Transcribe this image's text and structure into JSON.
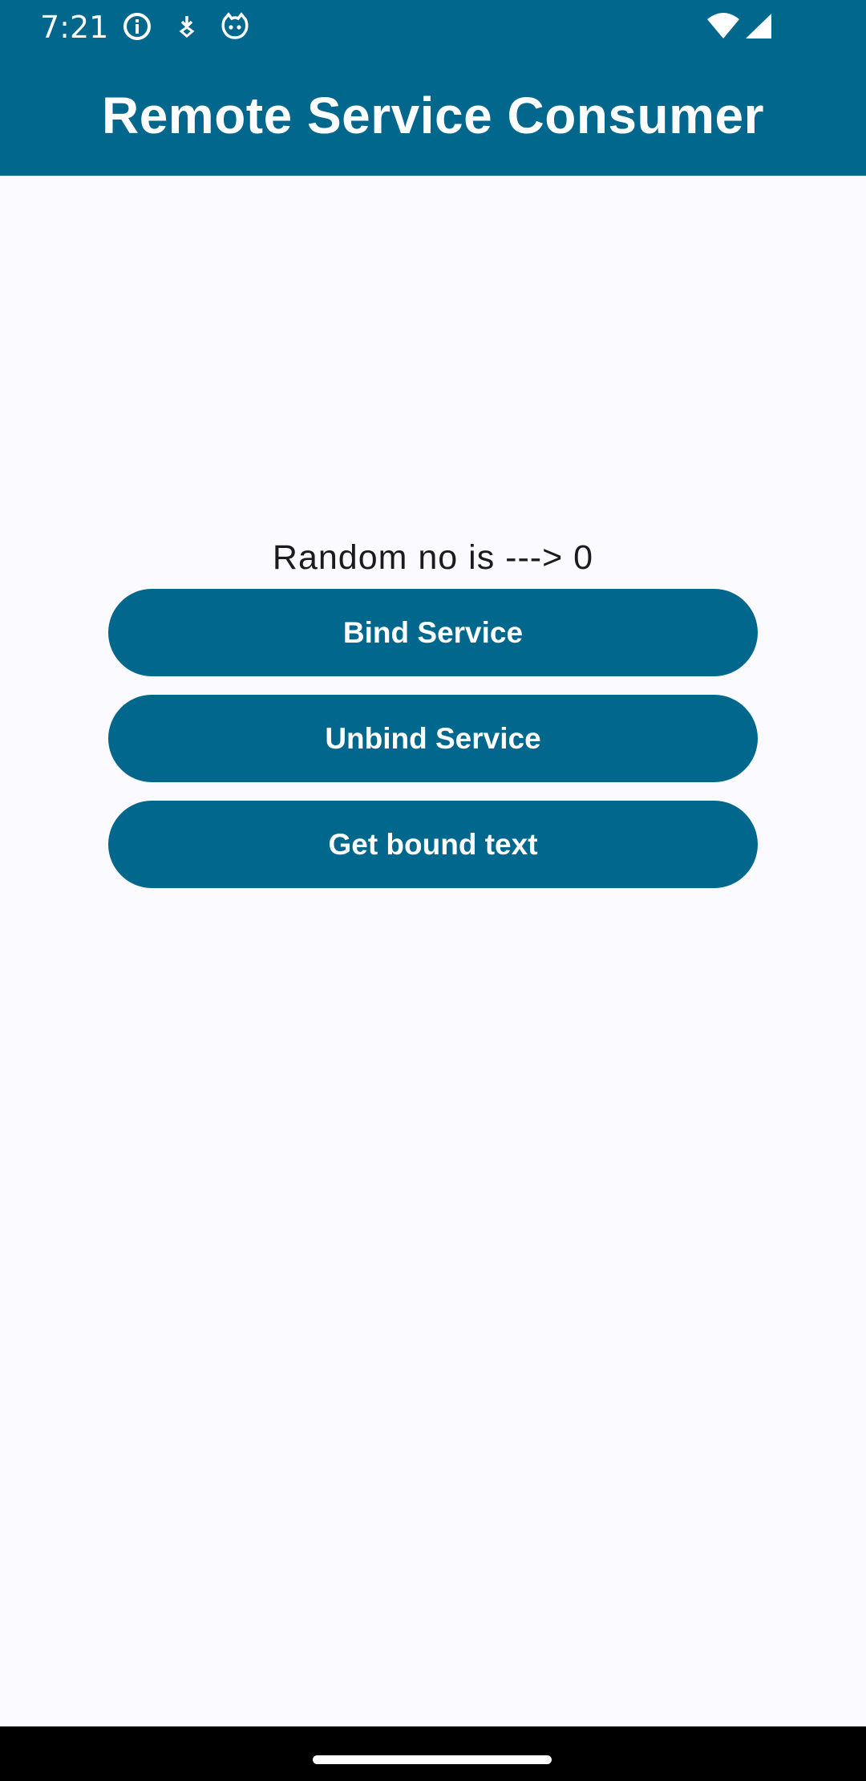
{
  "status_bar": {
    "time": "7:21",
    "icons": [
      "info-icon",
      "download-icon",
      "cat-face-icon"
    ],
    "right_icons": [
      "wifi-icon",
      "cellular-signal-icon"
    ]
  },
  "app_bar": {
    "title": "Remote Service Consumer"
  },
  "main": {
    "random_text": "Random no is ---> 0",
    "buttons": {
      "bind": "Bind Service",
      "unbind": "Unbind Service",
      "get_text": "Get bound text"
    }
  },
  "colors": {
    "primary": "#01678d",
    "background": "#fbfaff",
    "on_primary": "#ffffff",
    "text": "#1b1b1f"
  }
}
